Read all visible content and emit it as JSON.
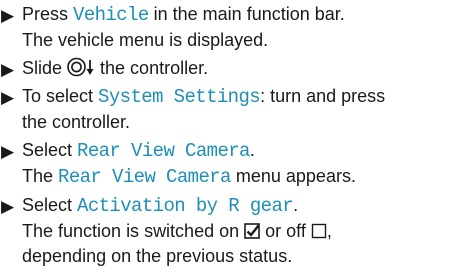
{
  "steps": [
    {
      "parts": {
        "pre": "Press ",
        "key": "Vehicle",
        "post": " in the main function bar."
      },
      "result": "The vehicle menu is displayed."
    },
    {
      "parts": {
        "pre": "Slide ",
        "post": " the controller."
      },
      "icon": "controller-slide-down-icon"
    },
    {
      "parts": {
        "pre": "To select ",
        "key": "System Settings",
        "post": ": turn and press"
      },
      "line2": "the controller."
    },
    {
      "parts": {
        "pre": "Select ",
        "key": "Rear View Camera",
        "post": "."
      },
      "result": {
        "pre": "The ",
        "key": "Rear View Camera",
        "post": " menu appears."
      }
    },
    {
      "parts": {
        "pre": "Select ",
        "key": "Activation by R gear",
        "post": "."
      },
      "result": {
        "pre": "The function is switched on ",
        "mid": " or off ",
        "post": ","
      },
      "line3": "depending on the previous status.",
      "icons": [
        "checkbox-checked-icon",
        "checkbox-empty-icon"
      ]
    }
  ],
  "colors": {
    "text": "#1a1a1a",
    "key": "#1e8fb6"
  }
}
